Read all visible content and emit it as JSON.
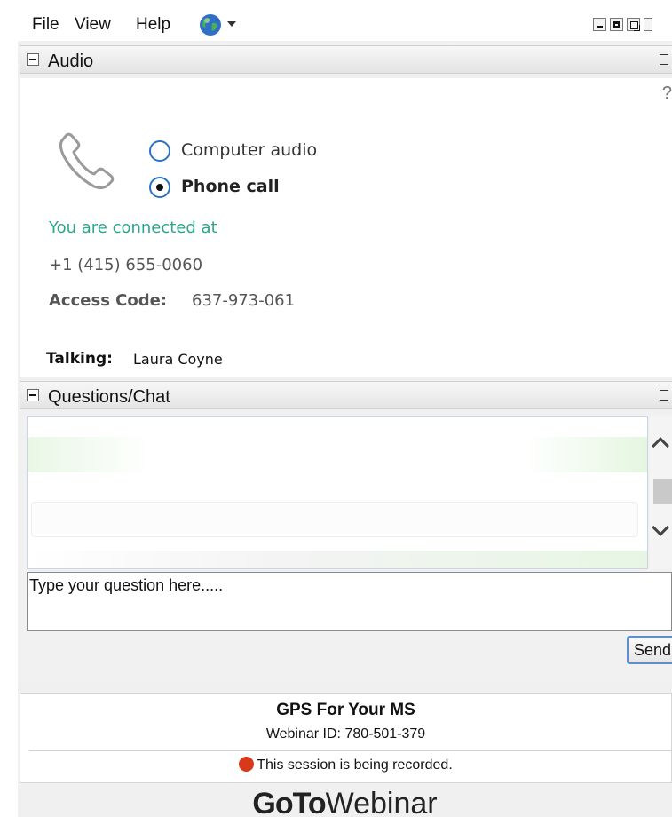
{
  "menu": {
    "file": "File",
    "view": "View",
    "help": "Help"
  },
  "audio": {
    "title": "Audio",
    "help": "?",
    "options": [
      {
        "label": "Computer audio",
        "selected": false
      },
      {
        "label": "Phone call",
        "selected": true
      }
    ],
    "connected_text": "You are connected at",
    "phone_number": "+1 (415) 655-0060",
    "access_code_label": "Access Code:",
    "access_code_value": "637-973-061",
    "talking_label": "Talking:",
    "talking_value": "Laura Coyne"
  },
  "chat": {
    "title": "Questions/Chat",
    "input_placeholder": "Type your question here.....",
    "send_label": "Send"
  },
  "info": {
    "webinar_title": "GPS For Your MS",
    "webinar_id": "Webinar ID: 780-501-379",
    "recording_text": "This session is being recorded."
  },
  "brand": {
    "bold": "GoTo",
    "light": "Webinar"
  },
  "colors": {
    "connected_green": "#2ca58d",
    "radio_blue": "#2a72c4",
    "recording_red": "#d8391b",
    "send_border": "#5b8fd1"
  }
}
